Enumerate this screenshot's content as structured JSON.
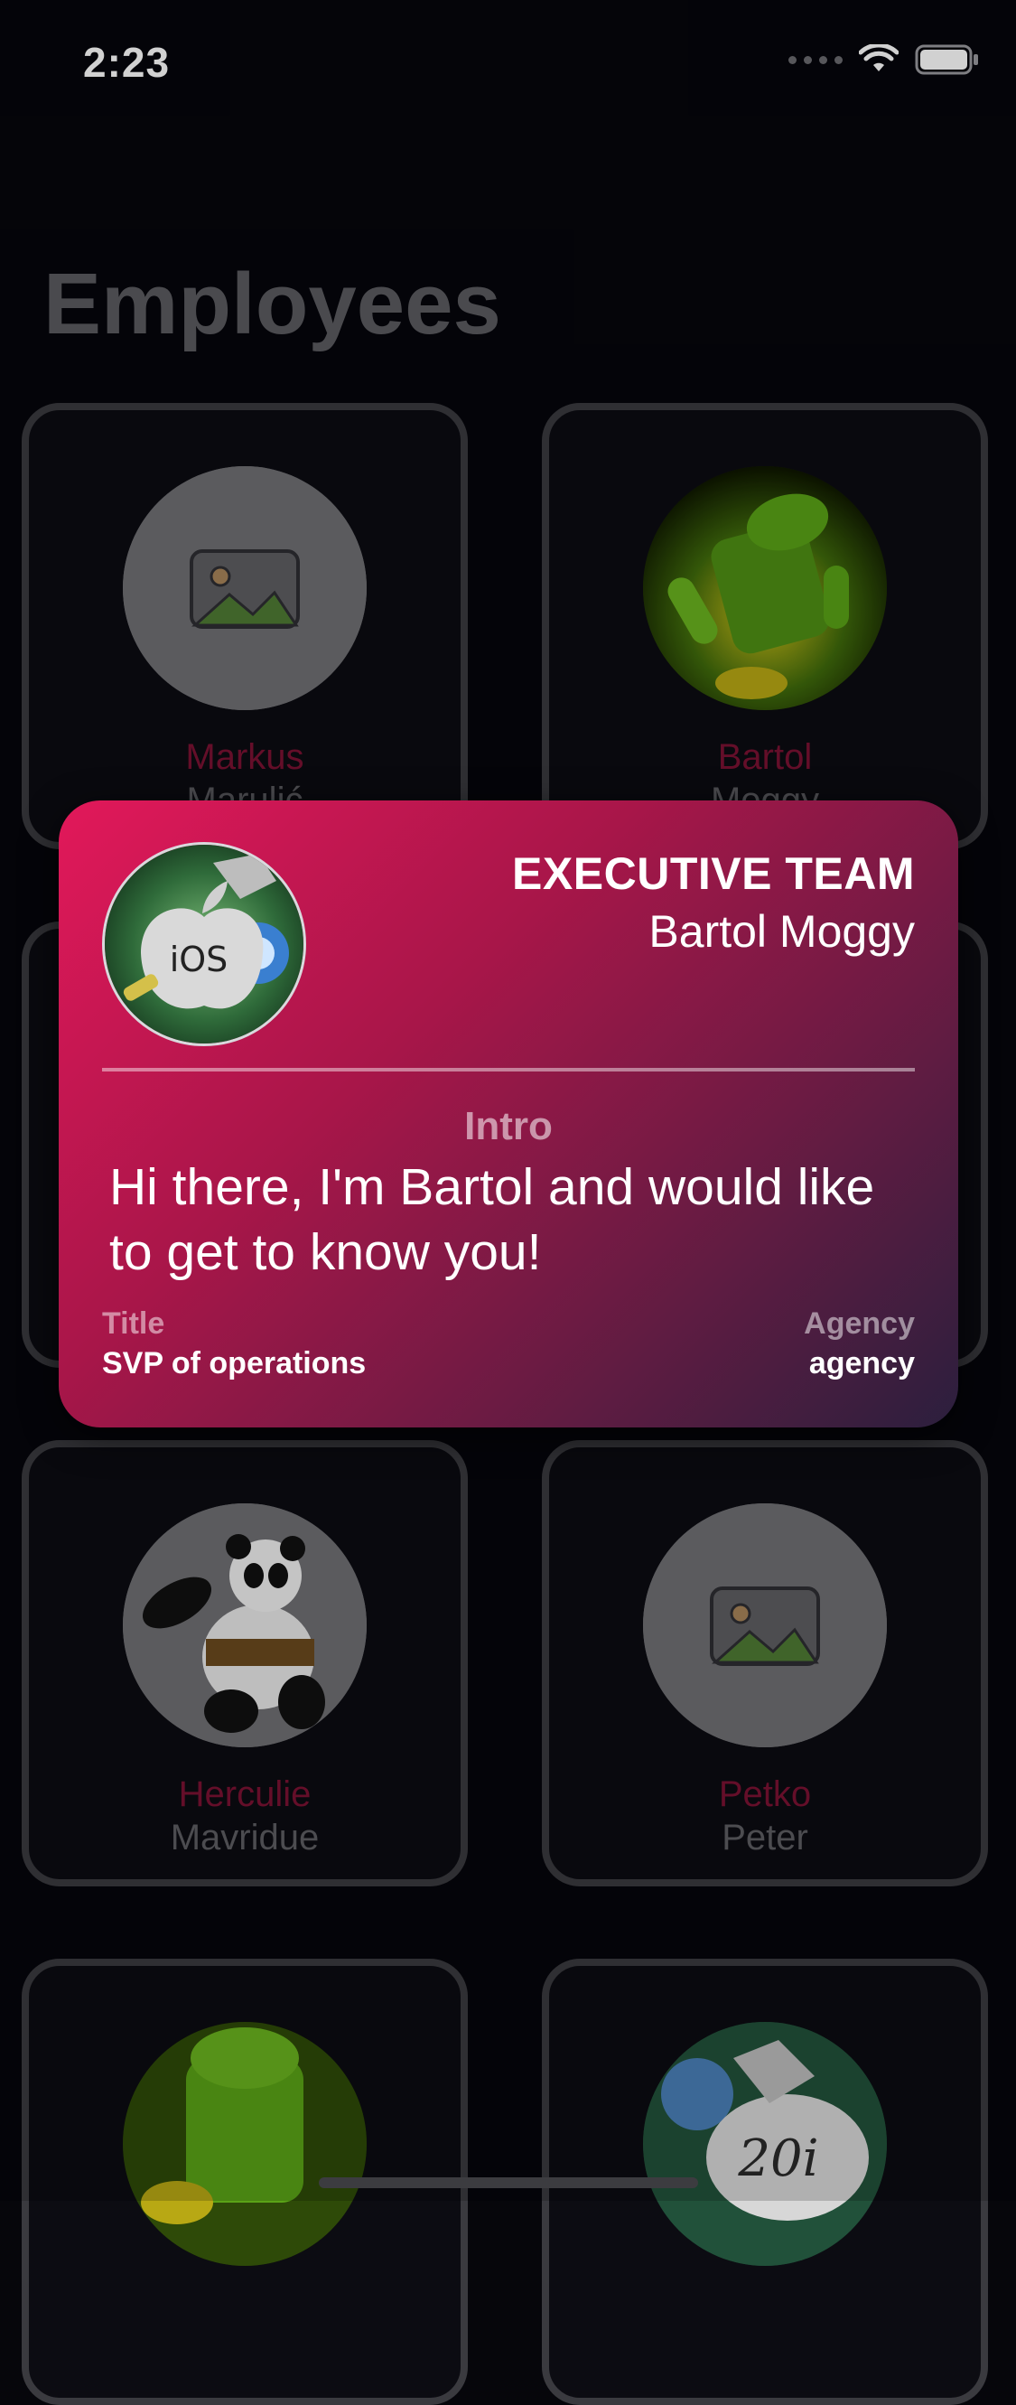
{
  "status_bar": {
    "time": "2:23"
  },
  "page": {
    "title": "Employees"
  },
  "employees": [
    {
      "first": "Markus",
      "last": "Marulić",
      "avatar": "placeholder-image-icon"
    },
    {
      "first": "Bartol",
      "last": "Moggy",
      "avatar": "android-robot-image"
    },
    {
      "first": "Herculie",
      "last": "Mavridue",
      "avatar": "panda-image"
    },
    {
      "first": "Petko",
      "last": "Peter",
      "avatar": "placeholder-image-icon"
    },
    {
      "first": "",
      "last": "",
      "avatar": "android-robot-image"
    },
    {
      "first": "",
      "last": "",
      "avatar": "robot-apple-20i-image"
    }
  ],
  "detail": {
    "team": "EXECUTIVE TEAM",
    "name": "Bartol Moggy",
    "intro_label": "Intro",
    "intro_text": "Hi there, I'm Bartol and would like to get to know you!",
    "title_label": "Title",
    "title_value": "SVP of operations",
    "agency_label": "Agency",
    "agency_value": "agency",
    "avatar": "robot-apple-ios-image"
  },
  "colors": {
    "background": "#06060b",
    "accent_name": "#7a1233",
    "gradient_start": "#e2185a",
    "gradient_end": "#2b1f3d"
  }
}
